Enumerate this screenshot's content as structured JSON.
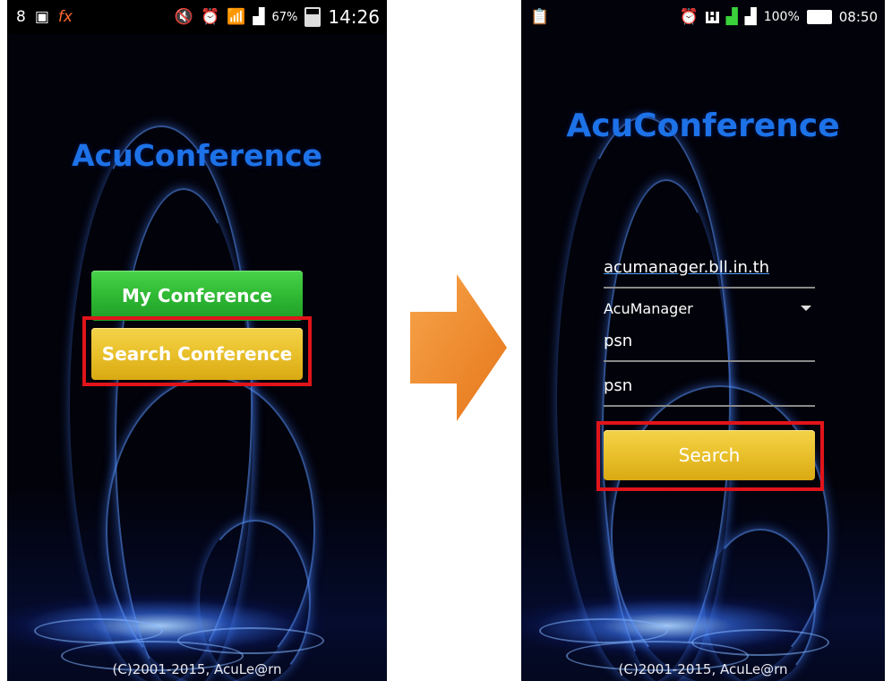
{
  "left_screen": {
    "status_left_icons": [
      "8",
      "gallery-icon",
      "fx"
    ],
    "status_battery_pct": "67%",
    "status_time": "14:26",
    "app_title": "AcuConference",
    "my_conference_label": "My Conference",
    "search_conference_label": "Search Conference",
    "footer": "(C)2001-2015, AcuLe@rn"
  },
  "right_screen": {
    "status_battery_pct": "100%",
    "status_time": "08:50",
    "app_title": "AcuConference",
    "server_value": "acumanager.bll.in.th",
    "server_type_selected": "AcuManager",
    "username_value": "psn",
    "password_value": "psn",
    "search_label": "Search",
    "footer": "(C)2001-2015, AcuLe@rn"
  },
  "colors": {
    "title_blue": "#1d72e8",
    "green_button": "#2fb934",
    "yellow_button": "#eac22d",
    "highlight_red": "#e0141a",
    "arrow_orange": "#f08a22"
  }
}
